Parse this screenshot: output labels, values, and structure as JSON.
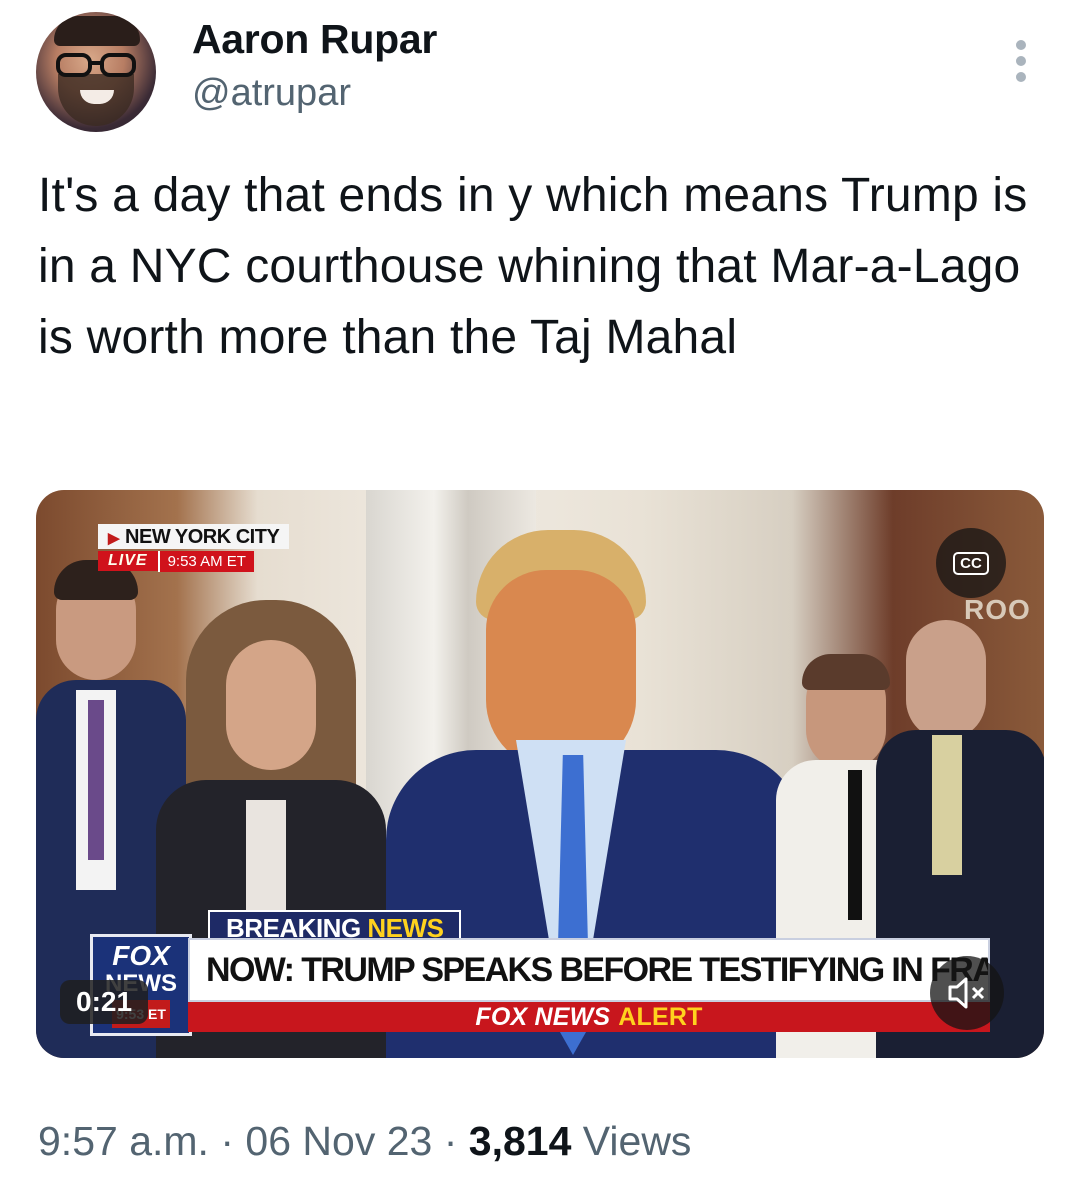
{
  "author": {
    "name": "Aaron Rupar",
    "handle": "@atrupar"
  },
  "tweet": {
    "text": "It's a day that ends in y which means Trump is in a NYC courthouse whining that Mar-a-Lago is worth more than the Taj Mahal"
  },
  "video": {
    "location": "NEW YORK CITY",
    "live_label": "LIVE",
    "live_time": "9:53 AM ET",
    "cc_label": "CC",
    "background_sign": "ROO",
    "breaking_label": "BREAKING",
    "breaking_news": "NEWS",
    "headline": "NOW: TRUMP SPEAKS BEFORE TESTIFYING IN FRAUD TRIAL",
    "alert_brand": "FOX NEWS",
    "alert_word": "ALERT",
    "logo_line1": "FOX",
    "logo_line2": "NEWS",
    "logo_time": "9:53 ET",
    "elapsed": "0:21",
    "mute_icon": "speaker-muted-icon"
  },
  "footer": {
    "time": "9:57 a.m.",
    "separator": "·",
    "date": "06 Nov 23",
    "views_count": "3,814",
    "views_label": "Views"
  },
  "colors": {
    "text_primary": "#0f1419",
    "text_secondary": "#536471",
    "fox_blue": "#1b3279",
    "fox_red": "#c8161d",
    "fox_yellow": "#ffd21e"
  }
}
